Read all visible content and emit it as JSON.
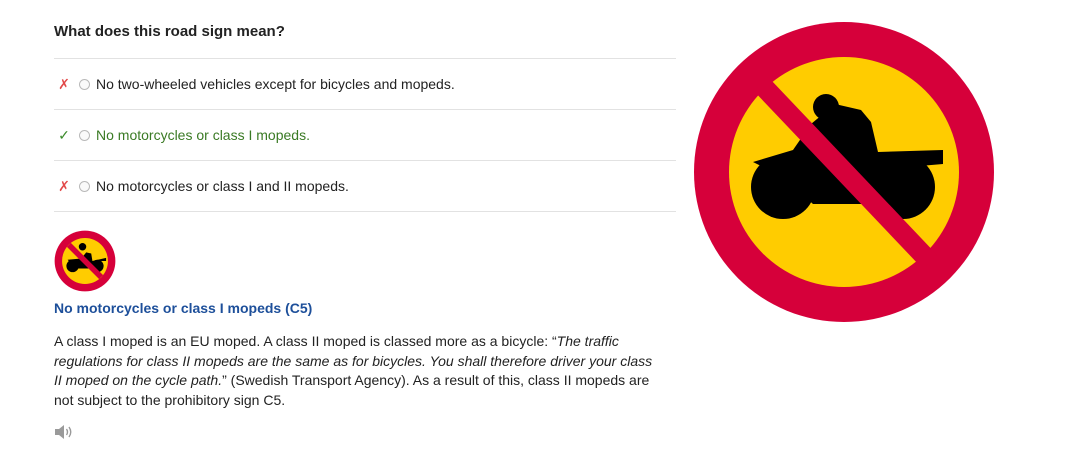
{
  "question": {
    "title": "What does this road sign mean?"
  },
  "answers": [
    {
      "mark": "✗",
      "status": "wrong",
      "text": "No two-wheeled vehicles except for bicycles and mopeds."
    },
    {
      "mark": "✓",
      "status": "correct",
      "text": "No motorcycles or class I mopeds."
    },
    {
      "mark": "✗",
      "status": "wrong",
      "text": "No motorcycles or class I and II mopeds."
    }
  ],
  "explanation": {
    "title": "No motorcycles or class I mopeds (C5)",
    "text_before": "A class I moped is an EU moped. A class II moped is classed more as a bicycle: “",
    "quote": "The traffic regulations for class II mopeds are the same as for bicycles. You shall therefore driver your class II moped on the cycle path.",
    "text_after": "” (Swedish Transport Agency). As a result of this, class II mopeds are not subject to the prohibitory sign C5."
  },
  "sign": {
    "name": "prohibition-motorcycle-sign",
    "ring_color": "#d6003a",
    "fill_color": "#ffcc00",
    "symbol_color": "#000000"
  },
  "colors": {
    "correct": "#3a7a24",
    "wrong": "#e24a4a",
    "link": "#1d4f9a"
  },
  "icons": {
    "speaker": "speaker-icon"
  }
}
